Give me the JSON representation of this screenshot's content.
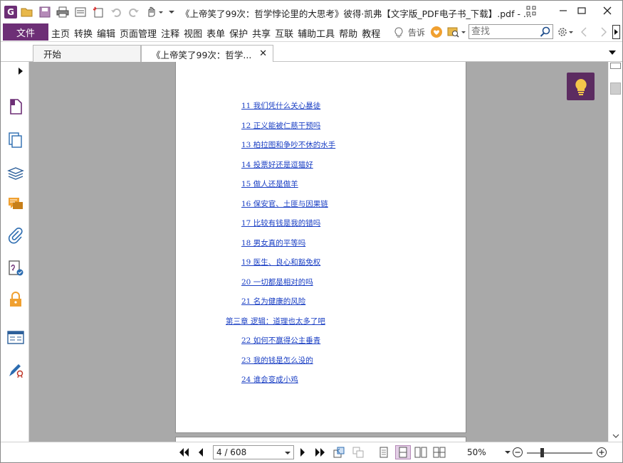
{
  "window": {
    "title": "《上帝笑了99次：哲学悖论里的大思考》彼得·凯弗【文字版_PDF电子书_下载】.pdf - ...",
    "logo_letter": "G"
  },
  "menu": {
    "file": "文件",
    "items": [
      "主页",
      "转换",
      "编辑",
      "页面管理",
      "注释",
      "视图",
      "表单",
      "保护",
      "共享",
      "互联",
      "辅助工具",
      "帮助",
      "教程"
    ],
    "tell_me": "告诉",
    "search_placeholder": "查找"
  },
  "tabs": [
    {
      "label": "开始",
      "active": false
    },
    {
      "label": "《上帝笑了99次：哲学...",
      "active": true
    }
  ],
  "document": {
    "toc": [
      {
        "text": "11 我们凭什么关心暴徒",
        "indent": 2
      },
      {
        "text": "12 正义能被仁慈干预吗",
        "indent": 2
      },
      {
        "text": "13 柏拉图和争吵不休的水手",
        "indent": 2
      },
      {
        "text": "14 投票好还是逗猫好",
        "indent": 2
      },
      {
        "text": "15 做人还是做羊",
        "indent": 2
      },
      {
        "text": "16 保安官、土匪与因果链",
        "indent": 2
      },
      {
        "text": "17 比较有钱是我的错吗",
        "indent": 2
      },
      {
        "text": "18 男女真的平等吗",
        "indent": 2
      },
      {
        "text": "19 医生、良心和豁免权",
        "indent": 2
      },
      {
        "text": "20 一切都是相对的吗",
        "indent": 2
      },
      {
        "text": "21 名为健康的风险",
        "indent": 2
      },
      {
        "text": "第三章 逻辑：道理也太多了吧",
        "indent": 1
      },
      {
        "text": "22 如何不赢得公主垂青",
        "indent": 2
      },
      {
        "text": "23 我的钱是怎么没的",
        "indent": 2
      },
      {
        "text": "24 谁会变成小鸡",
        "indent": 2
      }
    ]
  },
  "status": {
    "page_display": "4 / 608",
    "zoom": "50%",
    "zoom_level_percent": 50
  },
  "colors": {
    "brand": "#6d2f76",
    "tip_button": "#5c2c61",
    "link": "#1a3fc4",
    "workspace": "#a9a9a9"
  }
}
